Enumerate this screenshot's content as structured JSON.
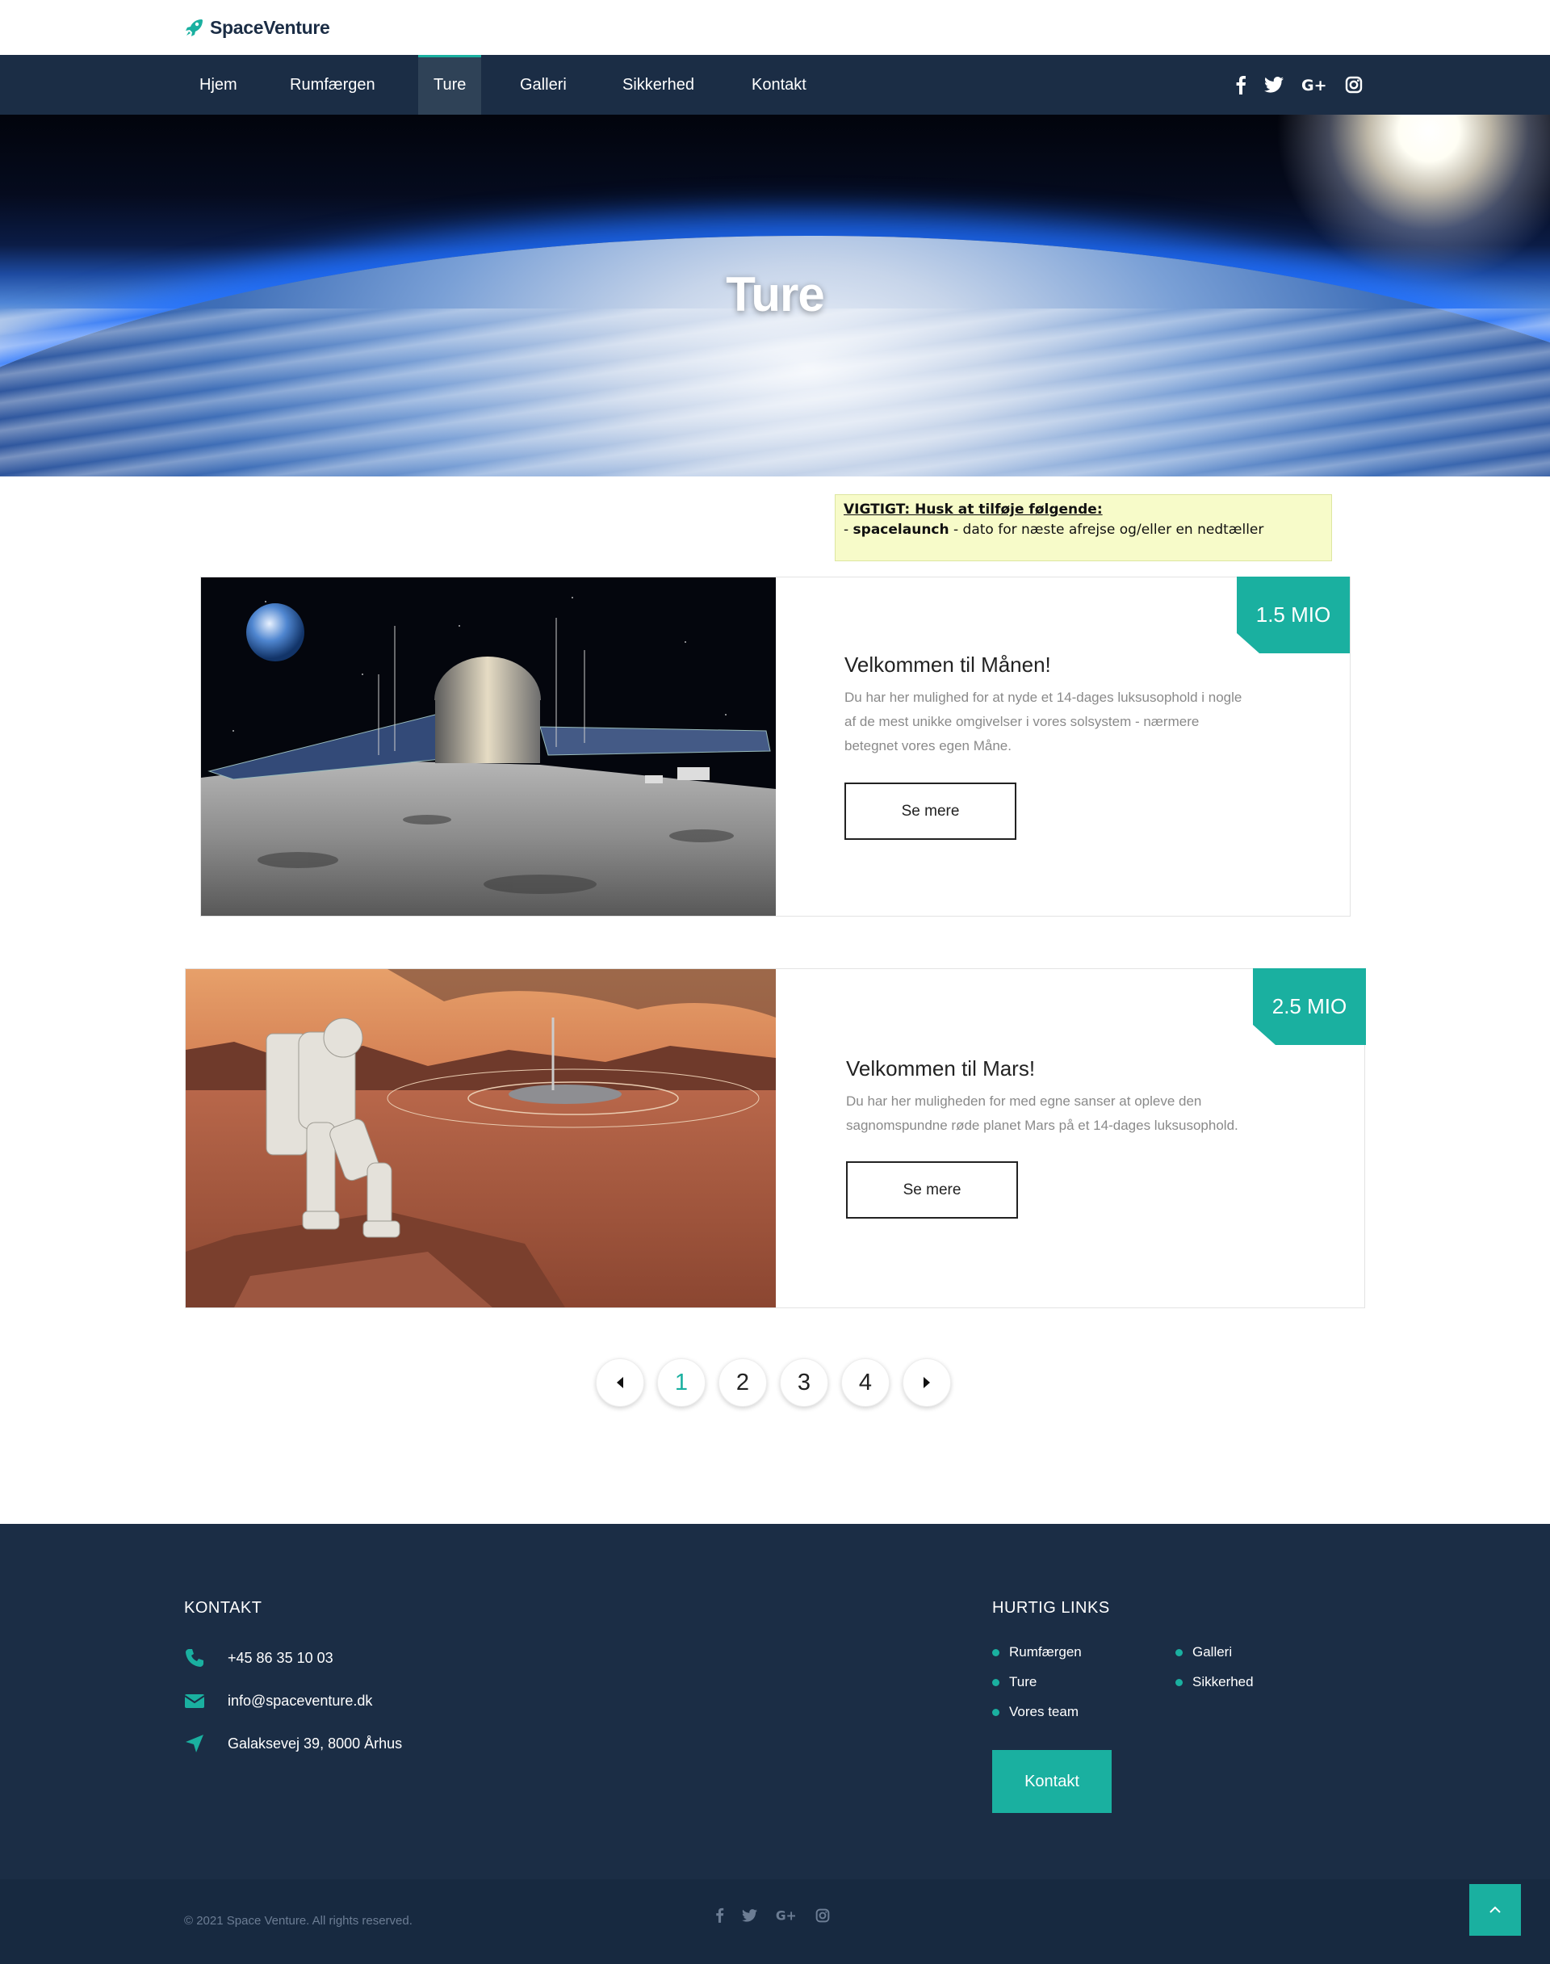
{
  "brand": {
    "name": "SpaceVenture",
    "accent": "#1ab0a0",
    "nav_bg": "#1b2d45"
  },
  "nav": {
    "items": [
      {
        "label": "Hjem"
      },
      {
        "label": "Rumfærgen"
      },
      {
        "label": "Ture"
      },
      {
        "label": "Galleri"
      },
      {
        "label": "Sikkerhed"
      },
      {
        "label": "Kontakt"
      }
    ],
    "active": "Ture",
    "social": [
      "facebook-icon",
      "twitter-icon",
      "google-plus-icon",
      "instagram-icon"
    ]
  },
  "hero": {
    "title": "Ture"
  },
  "notice": {
    "title": "VIGTIGT: Husk at tilføje følgende:",
    "prefix": "- ",
    "keyword": "spacelaunch",
    "rest": " - dato for næste afrejse og/eller en nedtæller"
  },
  "trips": [
    {
      "price": "1.5 MIO",
      "title": "Velkommen til Månen!",
      "description": "Du har her mulighed for at nyde et 14-dages luksusophold i nogle af de mest unikke omgivelser i vores solsystem - nærmere betegnet vores egen Måne.",
      "button": "Se mere"
    },
    {
      "price": "2.5 MIO",
      "title": "Velkommen til Mars!",
      "description": "Du har her muligheden for med egne sanser at opleve den sagnomspundne røde planet Mars på et 14-dages luksusophold.",
      "button": "Se mere"
    }
  ],
  "pagination": {
    "prev": "caret-left-icon",
    "pages": [
      "1",
      "2",
      "3",
      "4"
    ],
    "current": "1",
    "next": "caret-right-icon"
  },
  "footer": {
    "contact_heading": "KONTAKT",
    "phone": "+45 86 35 10 03",
    "email": "info@spaceventure.dk",
    "address": "Galaksevej 39, 8000 Århus",
    "links_heading": "HURTIG LINKS",
    "links": [
      "Rumfærgen",
      "Galleri",
      "Ture",
      "Sikkerhed",
      "Vores team"
    ],
    "button": "Kontakt",
    "copyright": "© 2021 Space Venture. All rights reserved."
  }
}
